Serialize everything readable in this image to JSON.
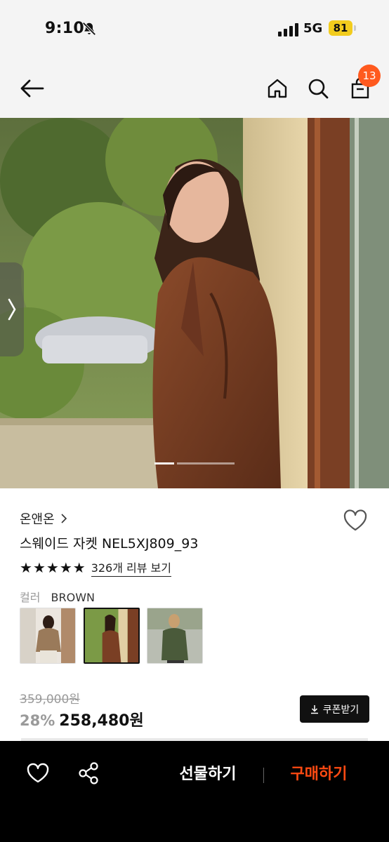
{
  "status_bar": {
    "time": "9:10",
    "network": "5G",
    "battery": "81"
  },
  "header": {
    "cart_count": "13",
    "icons": [
      "back-arrow-icon",
      "home-icon",
      "search-icon",
      "shopping-bag-icon"
    ]
  },
  "product": {
    "brand": "온앤온",
    "name": "스웨이드 자켓 NEL5XJ809_93",
    "rating_stars": 5,
    "review_link": "326개 리뷰 보기",
    "color_label": "컬러",
    "color_value": "BROWN",
    "selected_color_index": 1,
    "original_price": "359,000원",
    "discount": "28%",
    "price": "258,480원",
    "coupon_label": "쿠폰받기"
  },
  "bottom_bar": {
    "gift_label": "선물하기",
    "buy_label": "구매하기"
  },
  "colors": {
    "accent": "#ff4a12",
    "badge": "#ff5a1f",
    "battery": "#f2cc1d"
  }
}
